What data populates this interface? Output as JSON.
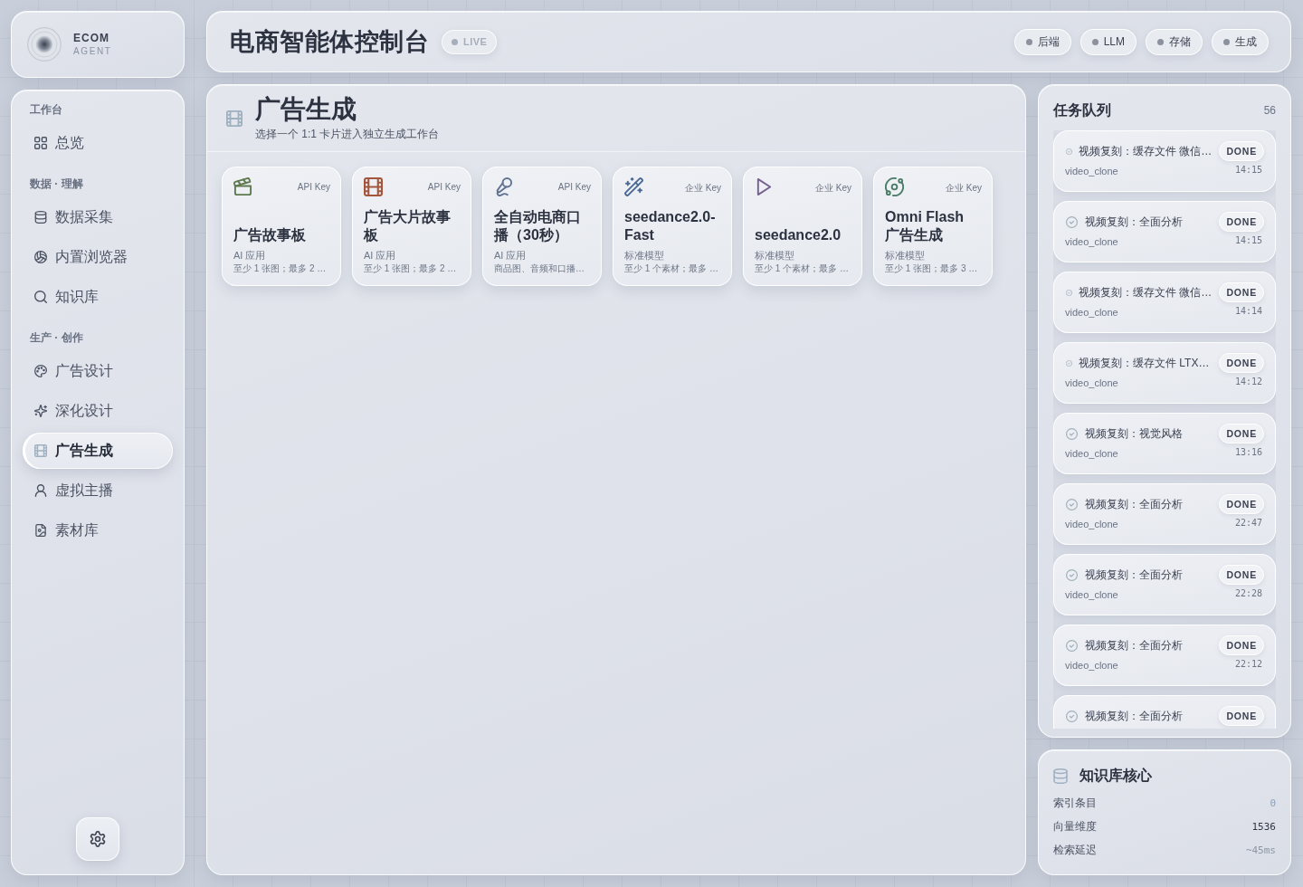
{
  "brand": {
    "name": "ECOM",
    "tagline": "AGENT"
  },
  "sidebar": {
    "sections": [
      {
        "label": "工作台",
        "items": [
          {
            "label": "总览",
            "selected": false
          }
        ]
      },
      {
        "label": "数据 · 理解",
        "items": [
          {
            "label": "数据采集",
            "selected": false
          },
          {
            "label": "内置浏览器",
            "selected": false
          },
          {
            "label": "知识库",
            "selected": false
          }
        ]
      },
      {
        "label": "生产 · 创作",
        "items": [
          {
            "label": "广告设计",
            "selected": false
          },
          {
            "label": "深化设计",
            "selected": false
          },
          {
            "label": "广告生成",
            "selected": true
          },
          {
            "label": "虚拟主播",
            "selected": false
          },
          {
            "label": "素材库",
            "selected": false
          }
        ]
      }
    ]
  },
  "header": {
    "title": "电商智能体控制台",
    "live": "LIVE",
    "services": [
      "后端",
      "LLM",
      "存储",
      "生成"
    ]
  },
  "main": {
    "title": "广告生成",
    "subtitle": "选择一个 1:1 卡片进入独立生成工作台",
    "cards": [
      {
        "tag": "API Key",
        "title": "广告故事板",
        "category": "AI 应用",
        "description": "至少 1 张图；最多 2 …",
        "color": "#5e7a4e"
      },
      {
        "tag": "API Key",
        "title": "广告大片故事板",
        "category": "AI 应用",
        "description": "至少 1 张图；最多 2 …",
        "color": "#a4563c"
      },
      {
        "tag": "API Key",
        "title": "全自动电商口播（30秒）",
        "category": "AI 应用",
        "description": "商品图、音频和口播…",
        "color": "#5f7390"
      },
      {
        "tag": "企业 Key",
        "title": "seedance2.0-Fast",
        "category": "标准模型",
        "description": "至少 1 个素材；最多 …",
        "color": "#4a6a95"
      },
      {
        "tag": "企业 Key",
        "title": "seedance2.0",
        "category": "标准模型",
        "description": "至少 1 个素材；最多 …",
        "color": "#75608f"
      },
      {
        "tag": "企业 Key",
        "title": "Omni Flash 广告生成",
        "category": "标准模型",
        "description": "至少 1 张图；最多 3 …",
        "color": "#4a7d68"
      }
    ]
  },
  "queue": {
    "title": "任务队列",
    "count": "56",
    "tasks": [
      {
        "kind": "cache",
        "title": "视频复刻：缓存文件 微信…",
        "badge": "DONE",
        "source": "video_clone",
        "time": "14:15"
      },
      {
        "kind": "analysis",
        "title": "视频复刻：全面分析",
        "badge": "DONE",
        "source": "video_clone",
        "time": "14:15"
      },
      {
        "kind": "cache",
        "title": "视频复刻：缓存文件 微信…",
        "badge": "DONE",
        "source": "video_clone",
        "time": "14:14"
      },
      {
        "kind": "cache",
        "title": "视频复刻：缓存文件 LTX…",
        "badge": "DONE",
        "source": "video_clone",
        "time": "14:12"
      },
      {
        "kind": "analysis",
        "title": "视频复刻：视觉风格",
        "badge": "DONE",
        "source": "video_clone",
        "time": "13:16"
      },
      {
        "kind": "analysis",
        "title": "视频复刻：全面分析",
        "badge": "DONE",
        "source": "video_clone",
        "time": "22:47"
      },
      {
        "kind": "analysis",
        "title": "视频复刻：全面分析",
        "badge": "DONE",
        "source": "video_clone",
        "time": "22:28"
      },
      {
        "kind": "analysis",
        "title": "视频复刻：全面分析",
        "badge": "DONE",
        "source": "video_clone",
        "time": "22:12"
      },
      {
        "kind": "analysis",
        "title": "视频复刻：全面分析",
        "badge": "DONE"
      }
    ]
  },
  "knowledge": {
    "title": "知识库核心",
    "stats": [
      {
        "label": "索引条目",
        "value": "0",
        "color": "#8fa2b8"
      },
      {
        "label": "向量维度",
        "value": "1536",
        "color": "#2f3542"
      },
      {
        "label": "检索延迟",
        "value": "~45ms",
        "color": "#8d96a4"
      }
    ]
  }
}
